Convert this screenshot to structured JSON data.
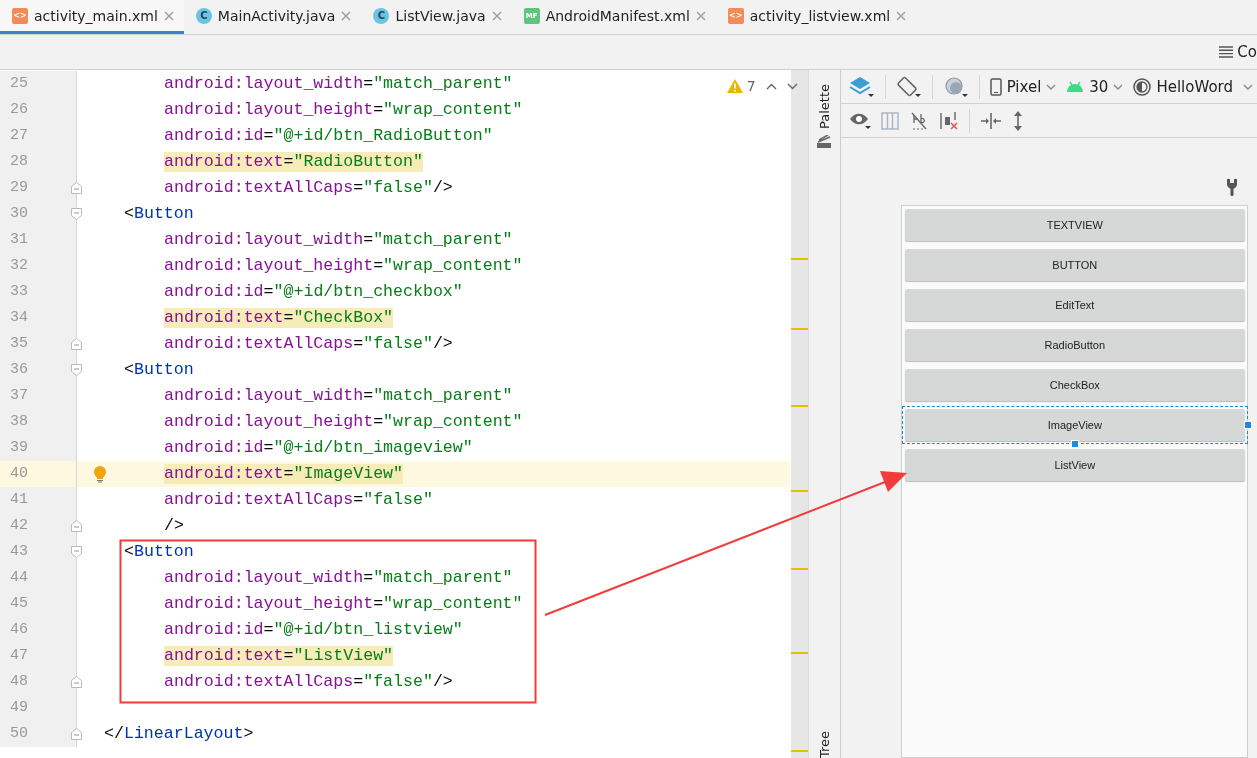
{
  "tabs": [
    {
      "label": "activity_main.xml",
      "kind": "xml",
      "glyph": "<>",
      "selected": true
    },
    {
      "label": "MainActivity.java",
      "kind": "class",
      "glyph": "C",
      "selected": false
    },
    {
      "label": "ListView.java",
      "kind": "class",
      "glyph": "C",
      "selected": false
    },
    {
      "label": "AndroidManifest.xml",
      "kind": "manifest",
      "glyph": "MF",
      "selected": false
    },
    {
      "label": "activity_listview.xml",
      "kind": "xml",
      "glyph": "<>",
      "selected": false
    }
  ],
  "toolbar": {
    "right_label": "Co"
  },
  "editor": {
    "warnings": "7",
    "lines": [
      {
        "number": "25",
        "kind": "attribute",
        "fold_start": false,
        "fold_end": false,
        "highlighted": false,
        "current": false,
        "tokens": [
          {
            "kind": "attr",
            "text": "android:layout_width"
          },
          {
            "kind": "punct",
            "text": "="
          },
          {
            "kind": "string",
            "text": "\"match_parent\""
          }
        ]
      },
      {
        "number": "26",
        "kind": "attribute",
        "fold_start": false,
        "fold_end": false,
        "highlighted": false,
        "current": false,
        "tokens": [
          {
            "kind": "attr",
            "text": "android:layout_height"
          },
          {
            "kind": "punct",
            "text": "="
          },
          {
            "kind": "string",
            "text": "\"wrap_content\""
          }
        ]
      },
      {
        "number": "27",
        "kind": "attribute",
        "fold_start": false,
        "fold_end": false,
        "highlighted": false,
        "current": false,
        "tokens": [
          {
            "kind": "attr",
            "text": "android:id"
          },
          {
            "kind": "punct",
            "text": "="
          },
          {
            "kind": "string",
            "text": "\"@+id/btn_RadioButton\""
          }
        ]
      },
      {
        "number": "28",
        "kind": "attribute",
        "fold_start": false,
        "fold_end": false,
        "highlighted": true,
        "current": false,
        "tokens": [
          {
            "kind": "attr",
            "text": "android:text"
          },
          {
            "kind": "punct",
            "text": "="
          },
          {
            "kind": "string",
            "text": "\"RadioButton\""
          }
        ]
      },
      {
        "number": "29",
        "kind": "attribute",
        "fold_start": false,
        "fold_end": true,
        "highlighted": false,
        "current": false,
        "tokens": [
          {
            "kind": "attr",
            "text": "android:textAllCaps"
          },
          {
            "kind": "punct",
            "text": "="
          },
          {
            "kind": "string",
            "text": "\"false\""
          },
          {
            "kind": "punct",
            "text": "/>"
          }
        ]
      },
      {
        "number": "30",
        "kind": "element",
        "fold_start": true,
        "fold_end": false,
        "highlighted": false,
        "current": false,
        "tokens": [
          {
            "kind": "punct",
            "text": "<"
          },
          {
            "kind": "tag",
            "text": "Button"
          }
        ]
      },
      {
        "number": "31",
        "kind": "attribute",
        "fold_start": false,
        "fold_end": false,
        "highlighted": false,
        "current": false,
        "tokens": [
          {
            "kind": "attr",
            "text": "android:layout_width"
          },
          {
            "kind": "punct",
            "text": "="
          },
          {
            "kind": "string",
            "text": "\"match_parent\""
          }
        ]
      },
      {
        "number": "32",
        "kind": "attribute",
        "fold_start": false,
        "fold_end": false,
        "highlighted": false,
        "current": false,
        "tokens": [
          {
            "kind": "attr",
            "text": "android:layout_height"
          },
          {
            "kind": "punct",
            "text": "="
          },
          {
            "kind": "string",
            "text": "\"wrap_content\""
          }
        ]
      },
      {
        "number": "33",
        "kind": "attribute",
        "fold_start": false,
        "fold_end": false,
        "highlighted": false,
        "current": false,
        "tokens": [
          {
            "kind": "attr",
            "text": "android:id"
          },
          {
            "kind": "punct",
            "text": "="
          },
          {
            "kind": "string",
            "text": "\"@+id/btn_checkbox\""
          }
        ]
      },
      {
        "number": "34",
        "kind": "attribute",
        "fold_start": false,
        "fold_end": false,
        "highlighted": true,
        "current": false,
        "tokens": [
          {
            "kind": "attr",
            "text": "android:text"
          },
          {
            "kind": "punct",
            "text": "="
          },
          {
            "kind": "string",
            "text": "\"CheckBox\""
          }
        ]
      },
      {
        "number": "35",
        "kind": "attribute",
        "fold_start": false,
        "fold_end": true,
        "highlighted": false,
        "current": false,
        "tokens": [
          {
            "kind": "attr",
            "text": "android:textAllCaps"
          },
          {
            "kind": "punct",
            "text": "="
          },
          {
            "kind": "string",
            "text": "\"false\""
          },
          {
            "kind": "punct",
            "text": "/>"
          }
        ]
      },
      {
        "number": "36",
        "kind": "element",
        "fold_start": true,
        "fold_end": false,
        "highlighted": false,
        "current": false,
        "tokens": [
          {
            "kind": "punct",
            "text": "<"
          },
          {
            "kind": "tag",
            "text": "Button"
          }
        ]
      },
      {
        "number": "37",
        "kind": "attribute",
        "fold_start": false,
        "fold_end": false,
        "highlighted": false,
        "current": false,
        "tokens": [
          {
            "kind": "attr",
            "text": "android:layout_width"
          },
          {
            "kind": "punct",
            "text": "="
          },
          {
            "kind": "string",
            "text": "\"match_parent\""
          }
        ]
      },
      {
        "number": "38",
        "kind": "attribute",
        "fold_start": false,
        "fold_end": false,
        "highlighted": false,
        "current": false,
        "tokens": [
          {
            "kind": "attr",
            "text": "android:layout_height"
          },
          {
            "kind": "punct",
            "text": "="
          },
          {
            "kind": "string",
            "text": "\"wrap_content\""
          }
        ]
      },
      {
        "number": "39",
        "kind": "attribute",
        "fold_start": false,
        "fold_end": false,
        "highlighted": false,
        "current": false,
        "tokens": [
          {
            "kind": "attr",
            "text": "android:id"
          },
          {
            "kind": "punct",
            "text": "="
          },
          {
            "kind": "string",
            "text": "\"@+id/btn_imageview\""
          }
        ]
      },
      {
        "number": "40",
        "kind": "attribute",
        "fold_start": false,
        "fold_end": false,
        "highlighted": true,
        "current": true,
        "tokens": [
          {
            "kind": "attr",
            "text": "android:text"
          },
          {
            "kind": "punct",
            "text": "="
          },
          {
            "kind": "string",
            "text": "\"ImageView\""
          }
        ]
      },
      {
        "number": "41",
        "kind": "attribute",
        "fold_start": false,
        "fold_end": false,
        "highlighted": false,
        "current": false,
        "tokens": [
          {
            "kind": "attr",
            "text": "android:textAllCaps"
          },
          {
            "kind": "punct",
            "text": "="
          },
          {
            "kind": "string",
            "text": "\"false\""
          }
        ]
      },
      {
        "number": "42",
        "kind": "attribute",
        "fold_start": false,
        "fold_end": true,
        "highlighted": false,
        "current": false,
        "tokens": [
          {
            "kind": "punct",
            "text": "/>"
          }
        ]
      },
      {
        "number": "43",
        "kind": "element",
        "fold_start": true,
        "fold_end": false,
        "highlighted": false,
        "current": false,
        "tokens": [
          {
            "kind": "punct",
            "text": "<"
          },
          {
            "kind": "tag",
            "text": "Button"
          }
        ]
      },
      {
        "number": "44",
        "kind": "attribute",
        "fold_start": false,
        "fold_end": false,
        "highlighted": false,
        "current": false,
        "tokens": [
          {
            "kind": "attr",
            "text": "android:layout_width"
          },
          {
            "kind": "punct",
            "text": "="
          },
          {
            "kind": "string",
            "text": "\"match_parent\""
          }
        ]
      },
      {
        "number": "45",
        "kind": "attribute",
        "fold_start": false,
        "fold_end": false,
        "highlighted": false,
        "current": false,
        "tokens": [
          {
            "kind": "attr",
            "text": "android:layout_height"
          },
          {
            "kind": "punct",
            "text": "="
          },
          {
            "kind": "string",
            "text": "\"wrap_content\""
          }
        ]
      },
      {
        "number": "46",
        "kind": "attribute",
        "fold_start": false,
        "fold_end": false,
        "highlighted": false,
        "current": false,
        "tokens": [
          {
            "kind": "attr",
            "text": "android:id"
          },
          {
            "kind": "punct",
            "text": "="
          },
          {
            "kind": "string",
            "text": "\"@+id/btn_listview\""
          }
        ]
      },
      {
        "number": "47",
        "kind": "attribute",
        "fold_start": false,
        "fold_end": false,
        "highlighted": true,
        "current": false,
        "tokens": [
          {
            "kind": "attr",
            "text": "android:text"
          },
          {
            "kind": "punct",
            "text": "="
          },
          {
            "kind": "string",
            "text": "\"ListView\""
          }
        ]
      },
      {
        "number": "48",
        "kind": "attribute",
        "fold_start": false,
        "fold_end": true,
        "highlighted": false,
        "current": false,
        "tokens": [
          {
            "kind": "attr",
            "text": "android:textAllCaps"
          },
          {
            "kind": "punct",
            "text": "="
          },
          {
            "kind": "string",
            "text": "\"false\""
          },
          {
            "kind": "punct",
            "text": "/>"
          }
        ]
      },
      {
        "number": "49",
        "kind": "empty",
        "fold_start": false,
        "fold_end": false,
        "current": false
      },
      {
        "number": "50",
        "kind": "root",
        "fold_start": false,
        "fold_end": true,
        "highlighted": false,
        "current": false,
        "tokens": [
          {
            "kind": "punct",
            "text": "</"
          },
          {
            "kind": "tag",
            "text": "LinearLayout"
          },
          {
            "kind": "punct",
            "text": ">"
          }
        ]
      }
    ]
  },
  "side_tabs": {
    "top": "Palette",
    "bottom": "Tree"
  },
  "design": {
    "device": "Pixel",
    "api": "30",
    "theme": "HelloWord",
    "preview_buttons": [
      {
        "label": "TEXTVIEW",
        "selected": false
      },
      {
        "label": "BUTTON",
        "selected": false
      },
      {
        "label": "EditText",
        "selected": false
      },
      {
        "label": "RadioButton",
        "selected": false
      },
      {
        "label": "CheckBox",
        "selected": false
      },
      {
        "label": "ImageView",
        "selected": true
      },
      {
        "label": "ListView",
        "selected": false
      }
    ]
  }
}
